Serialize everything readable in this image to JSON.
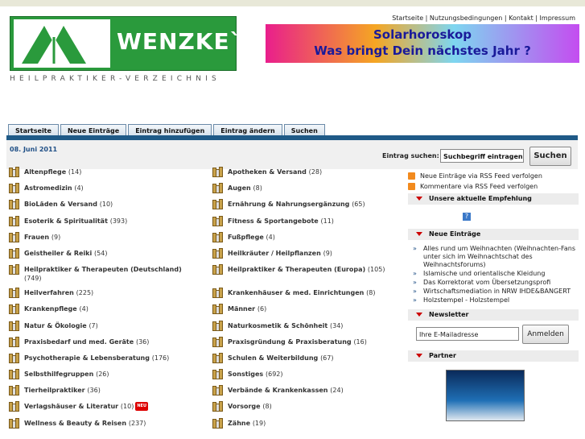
{
  "header": {
    "top_links": "Startseite | Nutzungsbedingungen | Kontakt | Impressum",
    "logo_text": "WENZKE`S",
    "logo_subtitle": "HEILPRAKTIKER-VERZEICHNIS",
    "banner_line1": "Solarhoroskop",
    "banner_line2": "Was bringt Dein nächstes Jahr ?"
  },
  "nav": {
    "tabs": [
      "Startseite",
      "Neue Einträge",
      "Eintrag hinzufügen",
      "Eintrag ändern",
      "Suchen"
    ]
  },
  "date": "08. Juni 2011",
  "search": {
    "label": "Eintrag suchen:",
    "value": "Suchbegriff eintragen",
    "button": "Suchen"
  },
  "categories_left": [
    {
      "name": "Altenpflege",
      "count": "(14)"
    },
    {
      "name": "Astromedizin",
      "count": "(4)"
    },
    {
      "name": "BioLäden & Versand",
      "count": "(10)"
    },
    {
      "name": "Esoterik & Spiritualität",
      "count": "(393)"
    },
    {
      "name": "Frauen",
      "count": "(9)"
    },
    {
      "name": "Geistheiler & Reiki",
      "count": "(54)"
    },
    {
      "name": "Heilpraktiker & Therapeuten (Deutschland)",
      "count": "(749)"
    },
    {
      "name": "Heilverfahren",
      "count": "(225)"
    },
    {
      "name": "Krankenpflege",
      "count": "(4)"
    },
    {
      "name": "Natur & Ökologie",
      "count": "(7)"
    },
    {
      "name": "Praxisbedarf und med. Geräte",
      "count": "(36)"
    },
    {
      "name": "Psychotherapie & Lebensberatung",
      "count": "(176)"
    },
    {
      "name": "Selbsthilfegruppen",
      "count": "(26)"
    },
    {
      "name": "Tierheilpraktiker",
      "count": "(36)"
    },
    {
      "name": "Verlagshäuser & Literatur",
      "count": "(10)",
      "badge": "NEU"
    },
    {
      "name": "Wellness & Beauty & Reisen",
      "count": "(237)"
    }
  ],
  "categories_right": [
    {
      "name": "Apotheken & Versand",
      "count": "(28)"
    },
    {
      "name": "Augen",
      "count": "(8)"
    },
    {
      "name": "Ernährung & Nahrungsergänzung",
      "count": "(65)"
    },
    {
      "name": "Fitness & Sportangebote",
      "count": "(11)"
    },
    {
      "name": "Fußpflege",
      "count": "(4)"
    },
    {
      "name": "Heilkräuter / Heilpflanzen",
      "count": "(9)"
    },
    {
      "name": "Heilpraktiker & Therapeuten (Europa)",
      "count": "(105)"
    },
    {
      "name": "Krankenhäuser & med. Einrichtungen",
      "count": "(8)"
    },
    {
      "name": "Männer",
      "count": "(6)"
    },
    {
      "name": "Naturkosmetik & Schönheit",
      "count": "(34)"
    },
    {
      "name": "Praxisgründung & Praxisberatung",
      "count": "(16)"
    },
    {
      "name": "Schulen & Weiterbildung",
      "count": "(67)"
    },
    {
      "name": "Sonstiges",
      "count": "(692)"
    },
    {
      "name": "Verbände & Krankenkassen",
      "count": "(24)"
    },
    {
      "name": "Vorsorge",
      "count": "(8)"
    },
    {
      "name": "Zähne",
      "count": "(19)"
    }
  ],
  "sidebar": {
    "rss1": "Neue Einträge via RSS Feed verfolgen",
    "rss2": "Kommentare via RSS Feed verfolgen",
    "recommend_title": "Unsere aktuelle Empfehlung",
    "recommend_icon": "?",
    "new_entries_title": "Neue Einträge",
    "new_entries": [
      "Alles rund um Weihnachten (Weihnachten-Fans unter sich im Weihnachtschat des Weihnachtsforums)",
      "Islamische und orientalische Kleidung",
      "Das Korrektorat vom Übersetzungsprofi",
      "Wirtschaftsmediation in NRW IHDE&BANGERT",
      "Holzstempel - Holzstempel"
    ],
    "newsletter_title": "Newsletter",
    "newsletter_value": "Ihre E-Mailadresse",
    "newsletter_button": "Anmelden",
    "partner_title": "Partner"
  }
}
